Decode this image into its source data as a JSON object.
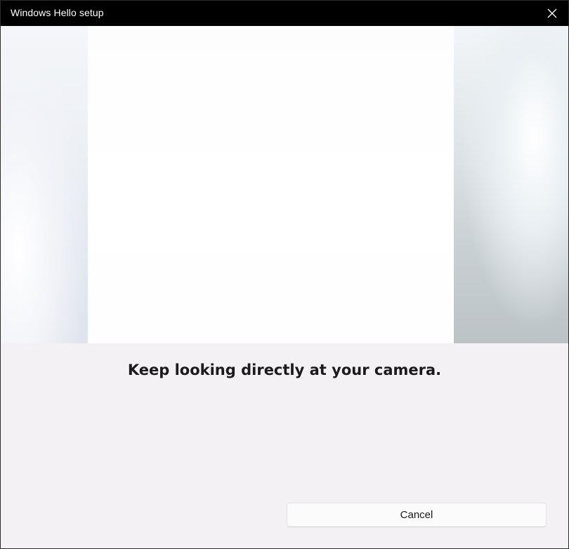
{
  "window": {
    "title": "Windows Hello setup",
    "close_icon": "close-icon"
  },
  "camera": {
    "description_icon": "camera-preview"
  },
  "main": {
    "instruction": "Keep looking directly at your camera."
  },
  "footer": {
    "cancel_label": "Cancel"
  },
  "colors": {
    "titlebar": "#000000",
    "body": "#f3f1f4",
    "button": "#fbfbfb"
  }
}
